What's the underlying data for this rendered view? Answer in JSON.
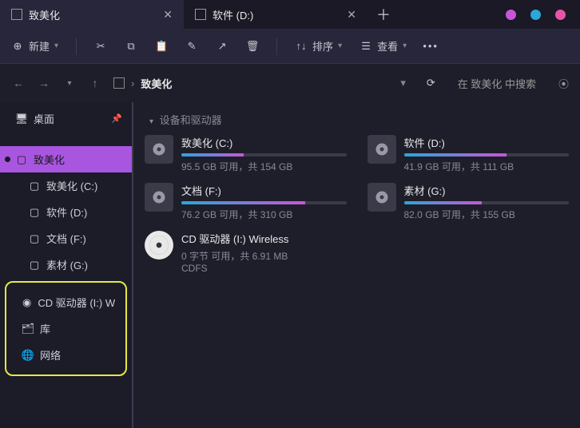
{
  "colors": {
    "accent": "#a855e0",
    "highlight": "#e5e843",
    "dot1": "#c855d8",
    "dot2": "#2aa8d8",
    "dot3": "#e855a8"
  },
  "tabs": [
    {
      "label": "致美化",
      "active": true
    },
    {
      "label": "软件 (D:)",
      "active": false
    }
  ],
  "toolbar": {
    "new_label": "新建",
    "sort_label": "排序",
    "view_label": "查看"
  },
  "breadcrumb": {
    "current": "致美化"
  },
  "search": {
    "placeholder": "在 致美化 中搜索"
  },
  "sidebar": {
    "desktop": "桌面",
    "active": "致美化",
    "drives": [
      {
        "label": "致美化 (C:)"
      },
      {
        "label": "软件 (D:)"
      },
      {
        "label": "文档 (F:)"
      },
      {
        "label": "素材 (G:)"
      }
    ],
    "highlighted": [
      {
        "label": "CD 驱动器 (I:) Wireless",
        "icon": "disc"
      },
      {
        "label": "库",
        "icon": "folder"
      },
      {
        "label": "网络",
        "icon": "globe"
      }
    ]
  },
  "content": {
    "section_title": "设备和驱动器",
    "drives": [
      {
        "name": "致美化 (C:)",
        "free": "95.5 GB 可用，共 154 GB",
        "pct": 38
      },
      {
        "name": "软件 (D:)",
        "free": "41.9 GB 可用，共 111 GB",
        "pct": 62
      },
      {
        "name": "文档 (F:)",
        "free": "76.2 GB 可用，共 310 GB",
        "pct": 75
      },
      {
        "name": "素材 (G:)",
        "free": "82.0 GB 可用，共 155 GB",
        "pct": 47
      },
      {
        "name": "CD 驱动器 (I:) Wireless",
        "free": "0 字节 可用，共 6.91 MB",
        "fs": "CDFS",
        "cd": true
      }
    ]
  }
}
